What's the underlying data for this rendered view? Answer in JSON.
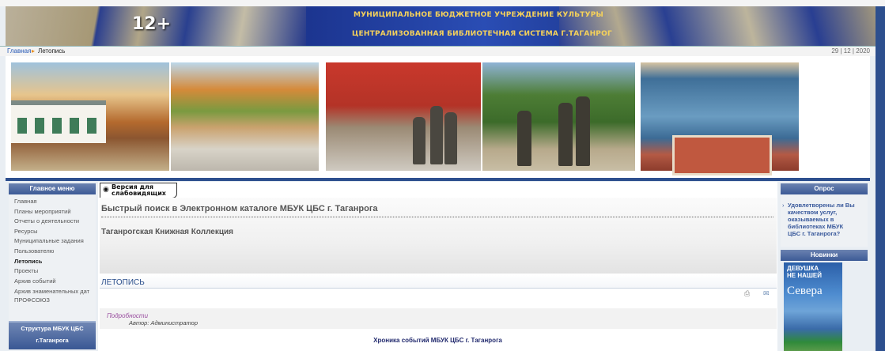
{
  "banner": {
    "age_rating": "12+",
    "title_line1": "МУНИЦИПАЛЬНОЕ БЮДЖЕТНОЕ УЧРЕЖДЕНИЕ КУЛЬТУРЫ",
    "title_line2": "ЦЕНТРАЛИЗОВАННАЯ БИБЛИОТЕЧНАЯ СИСТЕМА Г.ТАГАНРОГ"
  },
  "breadcrumb": {
    "home": "Главная",
    "separator": "▸",
    "current": "Летопись",
    "date": "29 | 12 | 2020"
  },
  "left_menu": {
    "title": "Главное меню",
    "items": [
      "Главная",
      "Планы мероприятий",
      "Отчеты о деятельности",
      "Ресурсы",
      "Муниципальные задания",
      "Пользователю",
      "Летопись",
      "Проекты",
      "Архив событий",
      "Архив знаменательных дат",
      "ПРОФСОЮЗ"
    ],
    "active_item": "Летопись",
    "structure_line1": "Структура МБУК ЦБС",
    "structure_line2": "г.Таганрога"
  },
  "main": {
    "blind_version_line1": "Версия для",
    "blind_version_line2": "слабовидящих",
    "quick_search": "Быстрый поиск в Электронном каталоге МБУК ЦБС г. Таганрога",
    "collection": "Таганрогская Книжная Коллекция",
    "article_title": "ЛЕТОПИСЬ",
    "details_link": "Подробности",
    "author": "Автор: Администратор",
    "chronicle": "Хроника событий МБУК ЦБС г. Таганрога"
  },
  "right_col": {
    "poll_title": "Опрос",
    "poll_question": "Удовлетворены ли Вы качеством услуг, оказываемых в библиотеках МБУК ЦБС г. Таганрога?",
    "new_title": "Новинки",
    "book_line1": "ДЕВУШКА",
    "book_line2": "НЕ НАШЕЙ",
    "book_title": "Севера"
  },
  "icons": {
    "print": "printer-icon",
    "email": "email-icon",
    "eye": "eye-icon"
  },
  "colors": {
    "accent": "#2d4f8e",
    "menu_header": "#3c5a96",
    "link": "#2a5bb7",
    "details": "#9a4fa0"
  }
}
